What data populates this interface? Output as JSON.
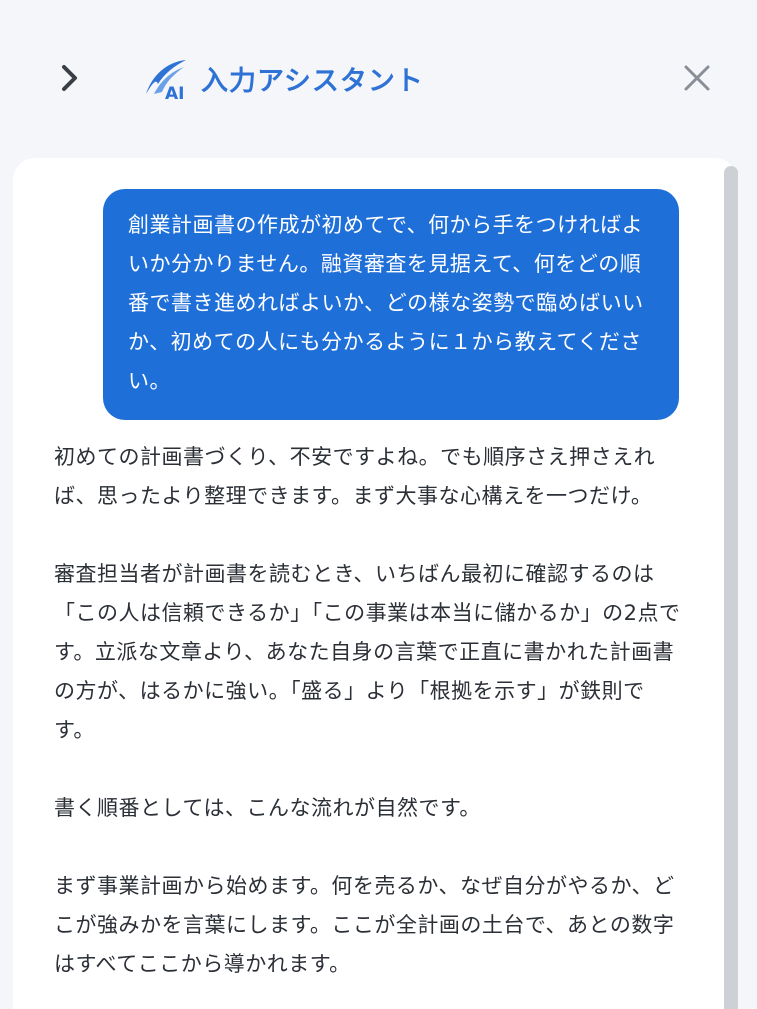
{
  "header": {
    "title": "入力アシスタント",
    "logo_text": "AI",
    "accent_color": "#2f72d6",
    "expand_icon": "chevron-right-icon",
    "close_icon": "close-icon"
  },
  "chat": {
    "user_message": "創業計画書の作成が初めてで、何から手をつければよいか分かりません。融資審査を見据えて、何をどの順番で書き進めればよいか、どの様な姿勢で臨めばいいか、初めての人にも分かるように１から教えてください。",
    "user_bubble_color": "#1f6fd9",
    "assistant_paragraphs": [
      "初めての計画書づくり、不安ですよね。でも順序さえ押さえれば、思ったより整理できます。まず大事な心構えを一つだけ。",
      "審査担当者が計画書を読むとき、いちばん最初に確認するのは「この人は信頼できるか」「この事業は本当に儲かるか」の2点です。立派な文章より、あなた自身の言葉で正直に書かれた計画書の方が、はるかに強い。「盛る」より「根拠を示す」が鉄則です。",
      "書く順番としては、こんな流れが自然です。",
      "まず事業計画から始めます。何を売るか、なぜ自分がやるか、どこが強みかを言葉にします。ここが全計画の土台で、あとの数字はすべてここから導かれます。"
    ]
  }
}
